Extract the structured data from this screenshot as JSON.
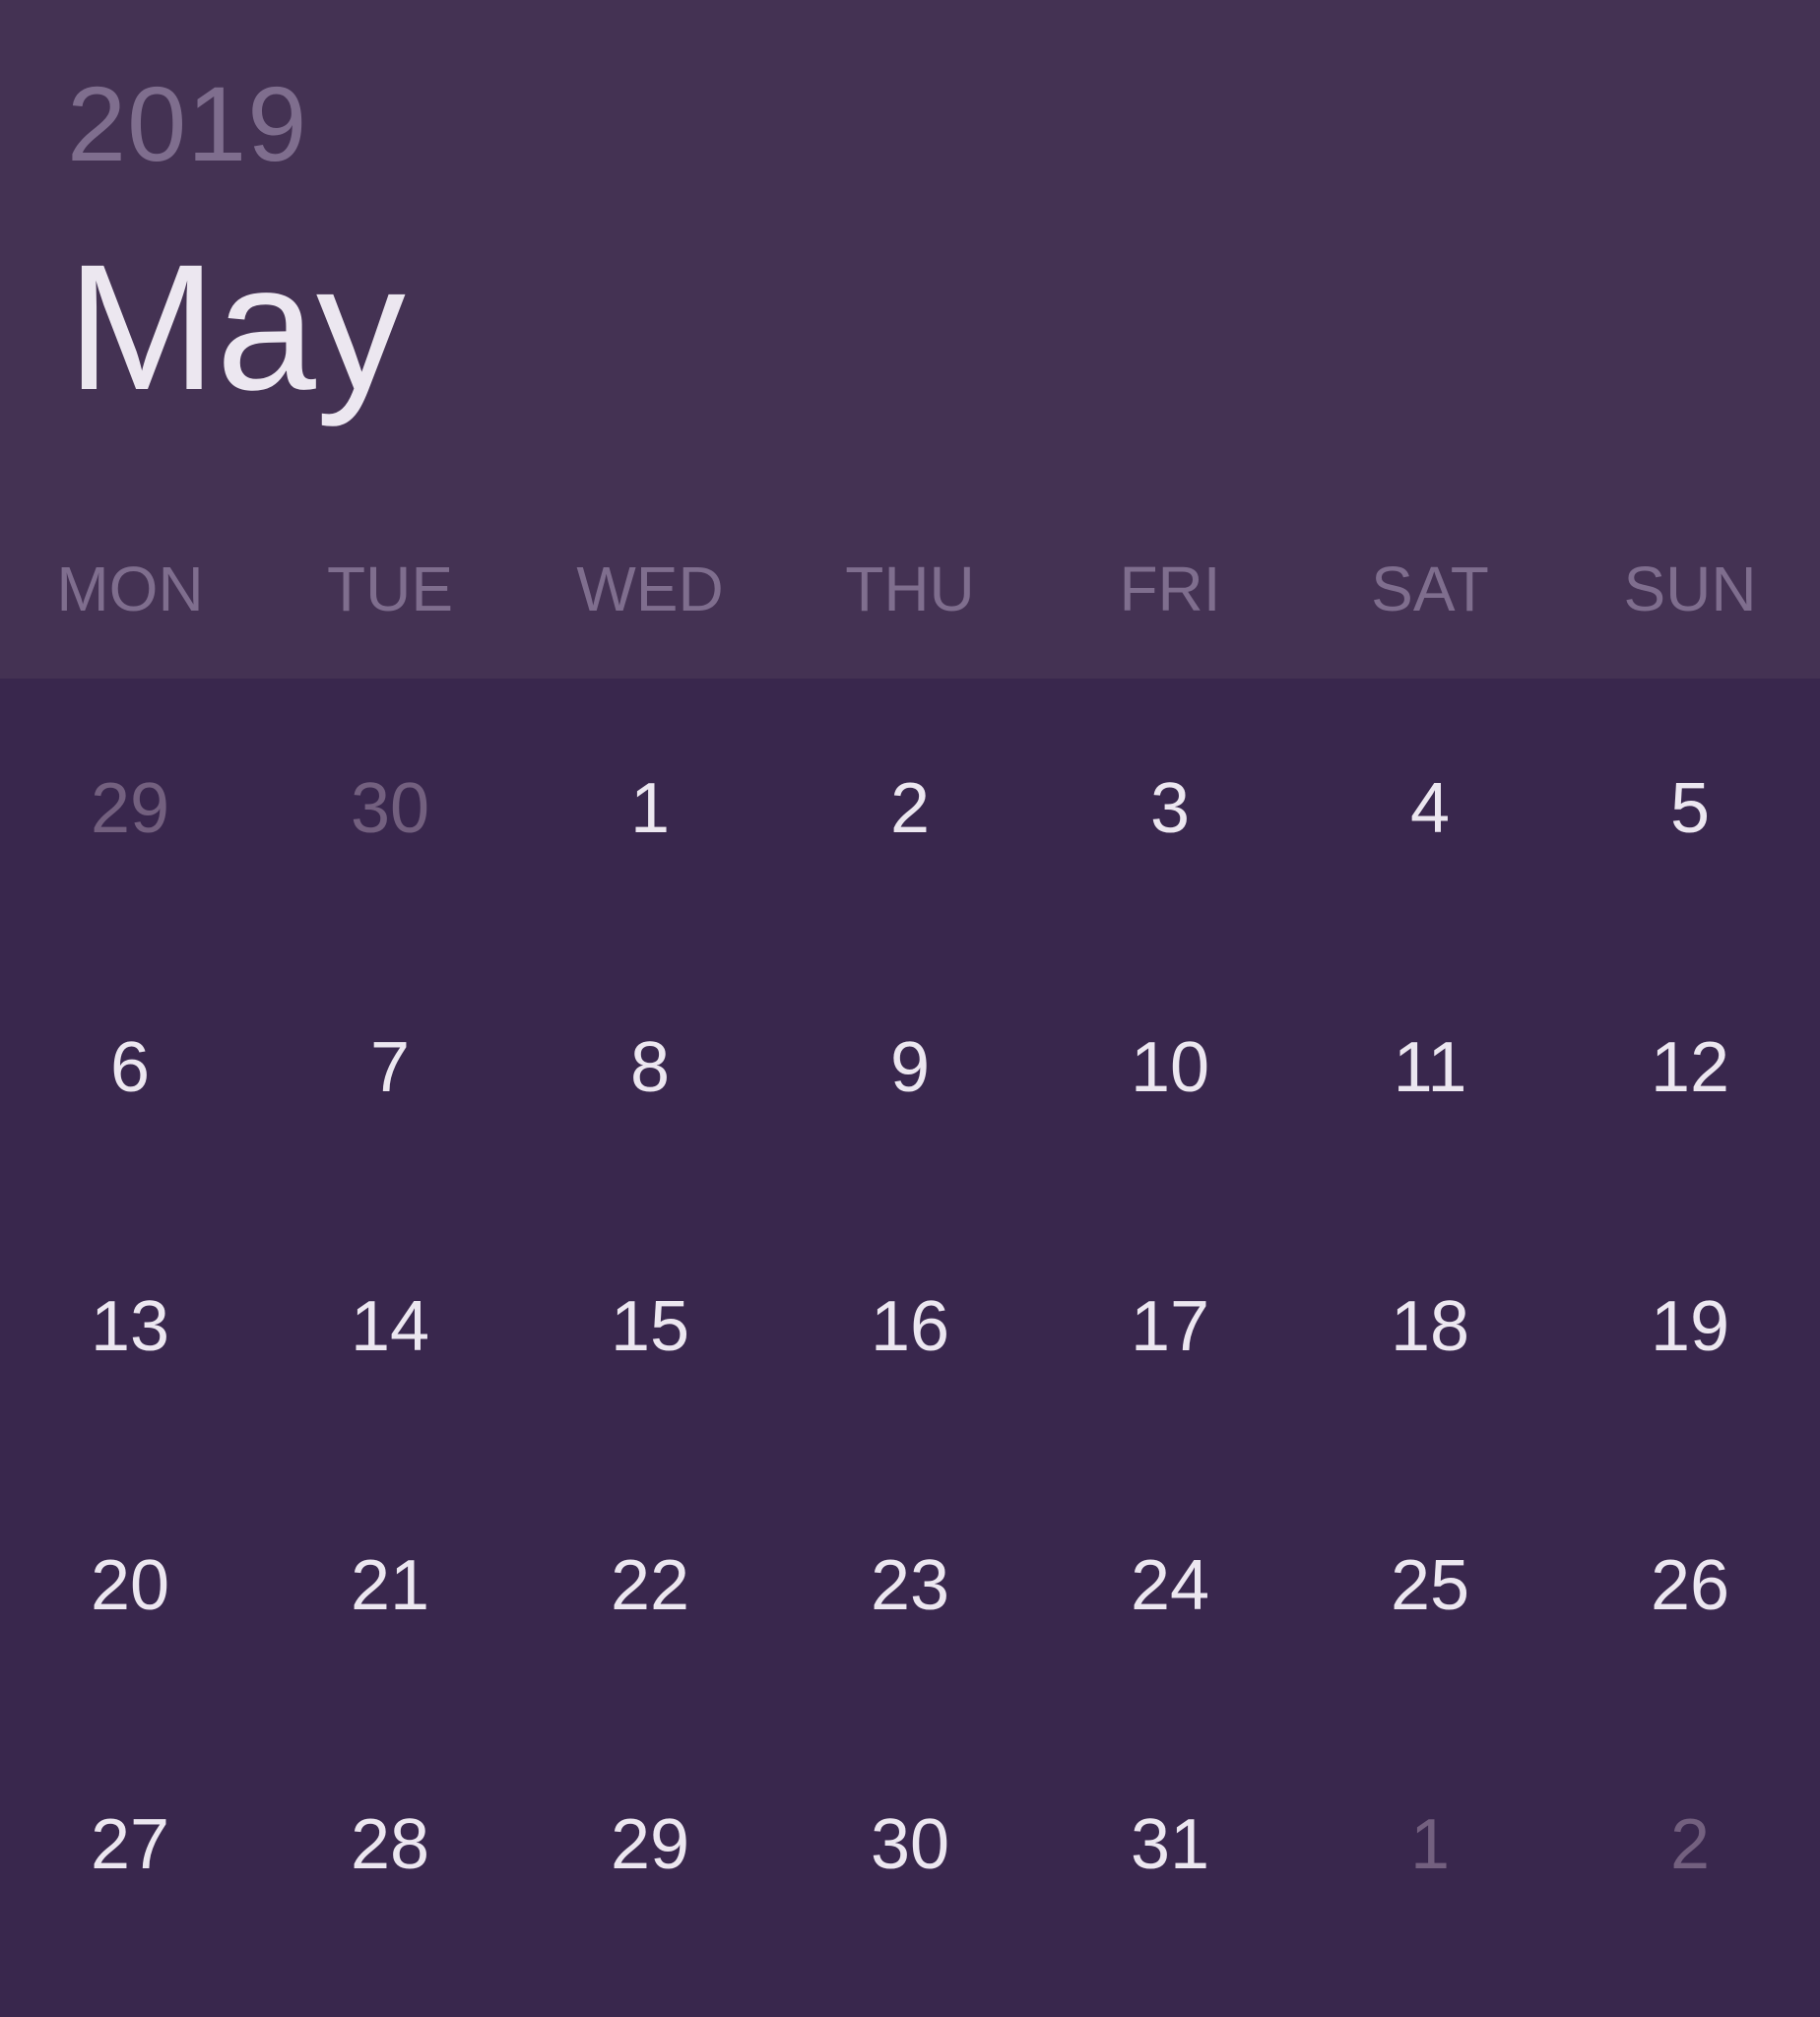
{
  "header": {
    "year": "2019",
    "month": "May"
  },
  "weekdays": [
    "MON",
    "TUE",
    "WED",
    "THU",
    "FRI",
    "SAT",
    "SUN"
  ],
  "days": [
    {
      "label": "29",
      "in_month": false
    },
    {
      "label": "30",
      "in_month": false
    },
    {
      "label": "1",
      "in_month": true
    },
    {
      "label": "2",
      "in_month": true
    },
    {
      "label": "3",
      "in_month": true
    },
    {
      "label": "4",
      "in_month": true
    },
    {
      "label": "5",
      "in_month": true
    },
    {
      "label": "6",
      "in_month": true
    },
    {
      "label": "7",
      "in_month": true
    },
    {
      "label": "8",
      "in_month": true
    },
    {
      "label": "9",
      "in_month": true
    },
    {
      "label": "10",
      "in_month": true
    },
    {
      "label": "11",
      "in_month": true
    },
    {
      "label": "12",
      "in_month": true
    },
    {
      "label": "13",
      "in_month": true
    },
    {
      "label": "14",
      "in_month": true
    },
    {
      "label": "15",
      "in_month": true
    },
    {
      "label": "16",
      "in_month": true
    },
    {
      "label": "17",
      "in_month": true
    },
    {
      "label": "18",
      "in_month": true
    },
    {
      "label": "19",
      "in_month": true
    },
    {
      "label": "20",
      "in_month": true
    },
    {
      "label": "21",
      "in_month": true
    },
    {
      "label": "22",
      "in_month": true
    },
    {
      "label": "23",
      "in_month": true
    },
    {
      "label": "24",
      "in_month": true
    },
    {
      "label": "25",
      "in_month": true
    },
    {
      "label": "26",
      "in_month": true
    },
    {
      "label": "27",
      "in_month": true
    },
    {
      "label": "28",
      "in_month": true
    },
    {
      "label": "29",
      "in_month": true
    },
    {
      "label": "30",
      "in_month": true
    },
    {
      "label": "31",
      "in_month": true
    },
    {
      "label": "1",
      "in_month": false
    },
    {
      "label": "2",
      "in_month": false
    }
  ],
  "colors": {
    "header_background": "#443253",
    "grid_background": "#39274d",
    "primary_text": "#ece7f0",
    "muted_text": "#7f6e8e"
  }
}
